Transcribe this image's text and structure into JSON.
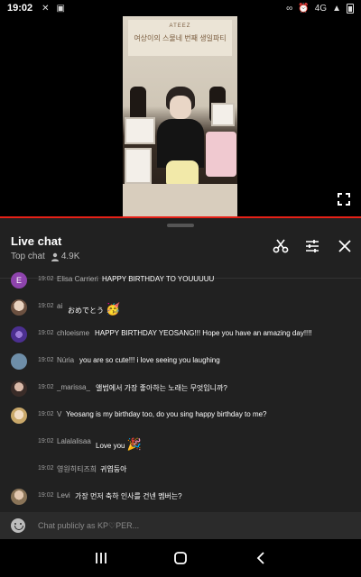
{
  "status_bar": {
    "time": "19:02",
    "left_icons": [
      "x-icon",
      "media-icon"
    ],
    "right_icons": [
      "link-icon",
      "alarm-icon",
      "signal-icon",
      "battery-icon"
    ],
    "signal_label": "4G"
  },
  "video": {
    "banner_subtitle": "ATEEZ",
    "banner_title": "여상이의 스물네 번째 생일파티"
  },
  "chat": {
    "title": "Live chat",
    "mode": "Top chat",
    "viewers": "4.9K",
    "messages": [
      {
        "time": "19:02",
        "author": "Elisa Carrieri",
        "text": "HAPPY BIRTHDAY TO YOUUUUU",
        "emoji": "",
        "avatar": "E",
        "avatar_color": "#8e44ad"
      },
      {
        "time": "19:02",
        "author": "ai",
        "text": "おめでとう",
        "emoji": "🥳",
        "avatar": "",
        "avatar_color": "#a08060"
      },
      {
        "time": "19:02",
        "author": "chloeisme",
        "text": "HAPPY BIRTHDAY YEOSANG!!! Hope you have an amazing day!!!!",
        "emoji": "",
        "avatar": "",
        "avatar_color": "#5b3fa0"
      },
      {
        "time": "19:02",
        "author": "Núria",
        "text": "you are so cute!!! i love seeing you laughing",
        "emoji": "",
        "avatar": "",
        "avatar_color": "#6e8ea8"
      },
      {
        "time": "19:02",
        "author": "_marissa_",
        "text": "앨범에서 가장 좋아하는 노래는 무엇입니까?",
        "emoji": "",
        "avatar": "",
        "avatar_color": "#4a3a34"
      },
      {
        "time": "19:02",
        "author": "V",
        "text": "Yeosang is my birthday too, do you sing happy birthday to me?",
        "emoji": "",
        "avatar": "",
        "avatar_color": "#c9b48a"
      },
      {
        "time": "19:02",
        "author": "Lalalalisaa",
        "text": "Love you",
        "emoji": "🎉",
        "avatar": "",
        "avatar_color": ""
      },
      {
        "time": "19:02",
        "author": "영원히티즈희",
        "text": "귀엽둥아",
        "emoji": "",
        "avatar": "",
        "avatar_color": ""
      },
      {
        "time": "19:02",
        "author": "Levi",
        "text": "가장 먼저 축하 인사를 건넨 멤버는?",
        "emoji": "",
        "avatar": "",
        "avatar_color": "#9a8a70"
      }
    ],
    "composer_placeholder": "Chat publicly as KP♡PER..."
  },
  "colors": {
    "chat_bg": "#212121",
    "accent_red": "#e62117"
  }
}
